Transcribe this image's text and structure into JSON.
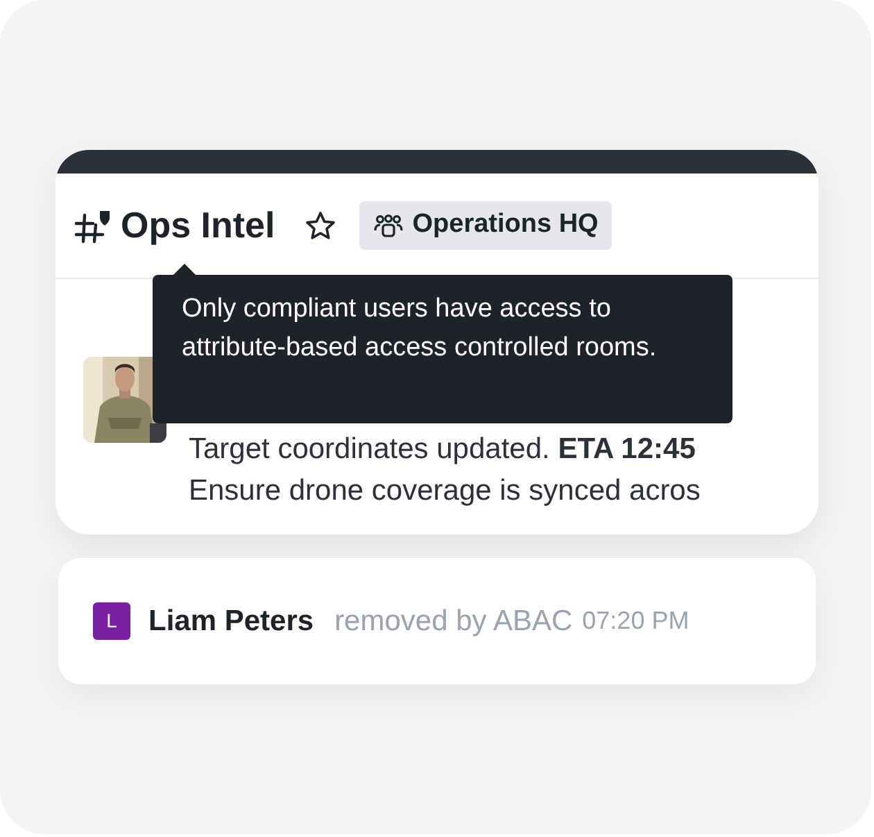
{
  "channel": {
    "name": "Ops Intel",
    "starred": false,
    "team": "Operations HQ"
  },
  "tooltip": "Only compliant users have access to attribute-based access controlled rooms.",
  "message": {
    "lines": [
      "Target coordinates updated. **ETA 12:45**",
      "Ensure drone coverage is synced acros"
    ]
  },
  "event": {
    "initial": "L",
    "color": "#7b1fa2",
    "name": "Liam Peters",
    "action": "removed by ABAC",
    "time": "07:20 PM"
  }
}
